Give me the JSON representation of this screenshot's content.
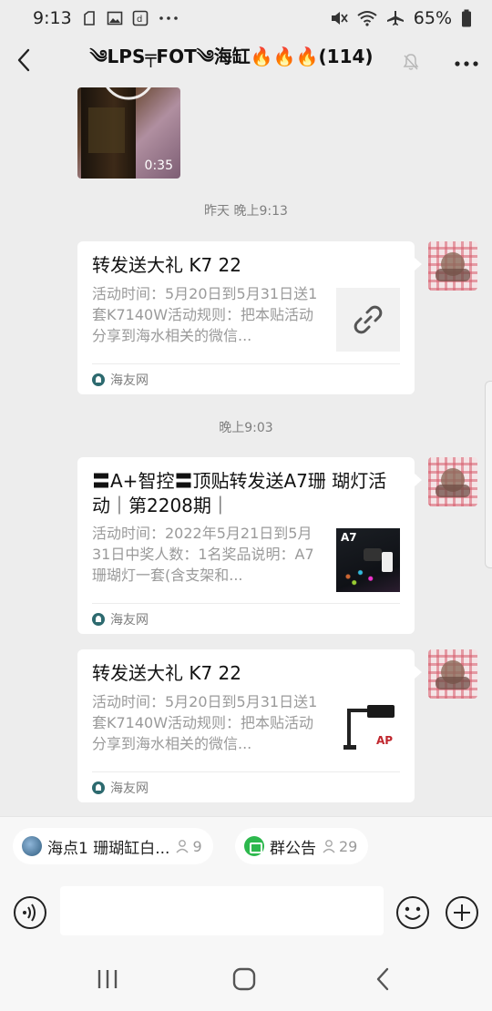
{
  "status_bar": {
    "time": "9:13",
    "battery": "65%",
    "left_icons": [
      "clipboard-icon",
      "image-icon",
      "d-app-icon",
      "more-dots-icon"
    ],
    "right_icons": [
      "mute-icon",
      "wifi-icon",
      "airplane-icon",
      "battery-icon"
    ]
  },
  "header": {
    "title": "༄LPS╤FOT༄海缸🔥🔥🔥(114)",
    "back_icon": "chevron-left-icon",
    "muted_icon": "bell-off-icon",
    "more_icon": "more-dots-icon"
  },
  "messages": {
    "video": {
      "duration": "0:35"
    },
    "ts1": "昨天 晚上9:13",
    "ts2": "晚上9:03",
    "card1": {
      "title": "转发送大礼 K7 22",
      "desc": "活动时间：5月20日到5月31日送1套K7140W活动规则：把本贴活动分享到海水相关的微信...",
      "source": "海友网",
      "thumb_icon": "link-icon"
    },
    "card2": {
      "title": "〓A+智控〓顶贴转发送A7珊 瑚灯活动｜第2208期｜",
      "desc": "活动时间：2022年5月21日到5月31日中奖人数：1名奖品说明：A7珊瑚灯一套(含支架和...",
      "source": "海友网",
      "thumb_text": "A7"
    },
    "card3": {
      "title": "转发送大礼 K7 22",
      "desc": "活动时间：5月20日到5月31日送1套K7140W活动规则：把本贴活动分享到海水相关的微信...",
      "source": "海友网",
      "thumb_brand": "AP"
    }
  },
  "quick_bar": {
    "chip1": {
      "label": "海点1 珊瑚缸白...",
      "count": "9"
    },
    "chip2": {
      "label": "群公告",
      "count": "29"
    }
  },
  "input_bar": {
    "voice_icon": "voice-icon",
    "emoji_icon": "emoji-icon",
    "plus_icon": "plus-circle-icon",
    "placeholder": ""
  },
  "nav_bar": {
    "recents_icon": "recents-icon",
    "home_icon": "home-icon",
    "back_icon": "back-icon"
  },
  "colors": {
    "background": "#ededed",
    "card": "#ffffff",
    "timestamp": "#7f7f7f",
    "notice_green": "#2db84d"
  }
}
